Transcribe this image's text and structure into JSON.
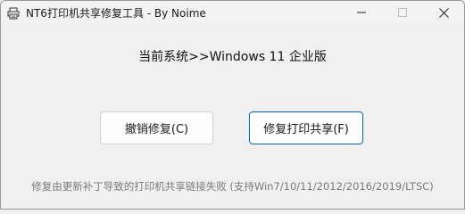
{
  "window": {
    "title": "NT6打印机共享修复工具 - By Noime",
    "controls": [
      "minimize",
      "maximize",
      "close"
    ]
  },
  "main": {
    "system_line": "当前系统>>Windows 11 企业版",
    "undo_button": "撤销修复(C)",
    "fix_button": "修复打印共享(F)",
    "footer": "修复由更新补丁导致的打印机共享链接失败 (支持Win7/10/11/2012/2016/2019/LTSC)"
  },
  "colors": {
    "accent": "#0067c0",
    "footer_text": "#7a7a7a"
  }
}
